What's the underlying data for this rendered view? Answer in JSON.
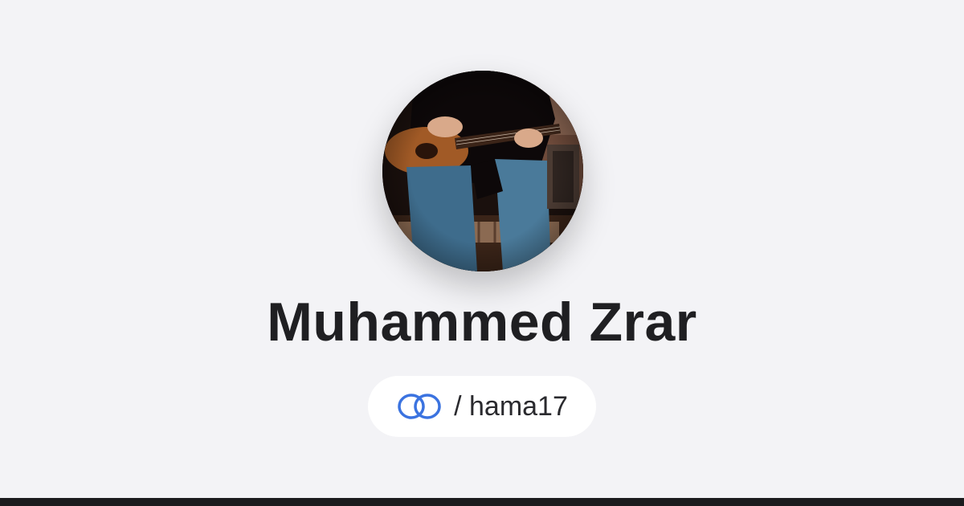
{
  "profile": {
    "name": "Muhammed Zrar",
    "handle": "/ hama17",
    "avatar_description_icon": "profile-photo",
    "link_icon": "linked-rings-icon"
  },
  "colors": {
    "background": "#f3f3f6",
    "name_text": "#1f1f22",
    "pill_background": "#ffffff",
    "link_icon": "#3b73e0",
    "footer_bar": "#1b1b1d"
  }
}
